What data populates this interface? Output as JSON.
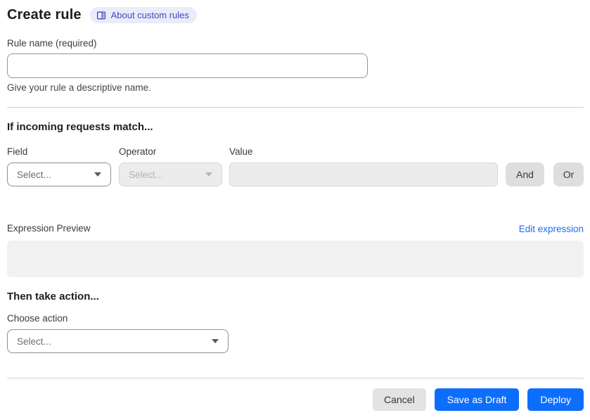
{
  "header": {
    "title": "Create rule",
    "about_link": "About custom rules"
  },
  "rule_name": {
    "label": "Rule name (required)",
    "value": "",
    "helper": "Give your rule a descriptive name."
  },
  "match": {
    "heading": "If incoming requests match...",
    "field_label": "Field",
    "field_value": "Select...",
    "operator_label": "Operator",
    "operator_value": "Select...",
    "value_label": "Value",
    "value_value": "",
    "and_button": "And",
    "or_button": "Or"
  },
  "expression": {
    "label": "Expression Preview",
    "edit_link": "Edit expression",
    "content": ""
  },
  "action": {
    "heading": "Then take action...",
    "label": "Choose action",
    "value": "Select..."
  },
  "footer": {
    "cancel": "Cancel",
    "save_draft": "Save as Draft",
    "deploy": "Deploy"
  },
  "colors": {
    "primary_blue": "#0d6efd",
    "link_blue": "#1a6ef0",
    "badge_bg": "#ebebfa",
    "badge_text": "#4545c9",
    "disabled_bg": "#ececec",
    "neutral_button_bg": "#dedede",
    "preview_bg": "#f1f1f1",
    "divider": "#d2d2d2"
  }
}
